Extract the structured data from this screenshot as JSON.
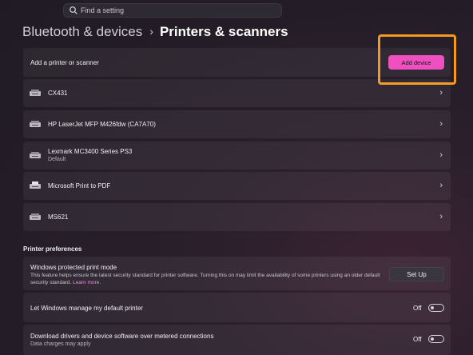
{
  "search": {
    "placeholder": "Find a setting"
  },
  "breadcrumb": {
    "parent": "Bluetooth & devices",
    "separator": "›",
    "current": "Printers & scanners"
  },
  "add_printer": {
    "label": "Add a printer or scanner",
    "button_label": "Add device"
  },
  "printers": [
    {
      "name": "CX431",
      "status": ""
    },
    {
      "name": "HP LaserJet MFP M426fdw (CA7A70)",
      "status": ""
    },
    {
      "name": "Lexmark MC3400 Series PS3",
      "status": "Default"
    },
    {
      "name": "Microsoft Print to PDF",
      "status": ""
    },
    {
      "name": "MS621",
      "status": ""
    }
  ],
  "preferences": {
    "title": "Printer preferences",
    "protected_mode": {
      "label": "Windows protected print mode",
      "description": "This feature helps ensure the latest security standard for printer software. Turning this on may limit the availability of some printers using an older default security standard.",
      "link": "Learn more.",
      "button_label": "Set Up"
    },
    "manage_default": {
      "label": "Let Windows manage my default printer",
      "state": "Off"
    },
    "metered": {
      "label": "Download drivers and device software over metered connections",
      "sub": "Data charges may apply",
      "state": "Off"
    }
  },
  "icons": {
    "search": "search-icon",
    "printer": "printer-icon",
    "chevron": "chevron-right-icon"
  },
  "colors": {
    "accent": "#f04fbf",
    "highlight": "#f59a1f"
  }
}
